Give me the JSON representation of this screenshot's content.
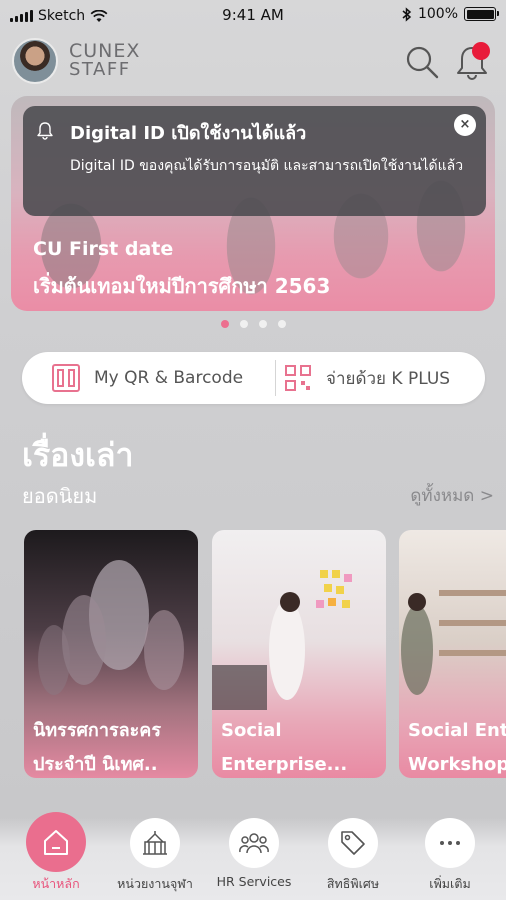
{
  "status_bar": {
    "carrier": "Sketch",
    "time": "9:41 AM",
    "battery": "100%",
    "battery_level": 1.0
  },
  "header": {
    "logo_top": "CUNEX",
    "logo_bottom": "STAFF",
    "search_icon": "search-icon",
    "bell_icon": "bell-icon",
    "has_unread_notification": true
  },
  "notification": {
    "title": "Digital ID เปิดใช้งานได้แล้ว",
    "body": "Digital ID ของคุณได้รับการอนุมัติ และสามารถเปิดใช้งานได้แล้ว",
    "close_symbol": "×"
  },
  "banner": {
    "line1": "CU First date",
    "line2": "เริ่มต้นเทอมใหม่ปีการศึกษา 2563",
    "slide_count": 4,
    "active_slide": 1
  },
  "actions": {
    "qr_label": "My QR & Barcode",
    "kplus_label": "จ่ายด้วย K PLUS"
  },
  "stories": {
    "title": "เรื่องเล่า",
    "subtitle": "ยอดนิยม",
    "see_all": "ดูทั้งหมด >",
    "cards": [
      {
        "line1": "นิทรรศการละคร",
        "line2": "ประจำปี นิเทศ.."
      },
      {
        "line1": "Social",
        "line2": "Enterprise..."
      },
      {
        "line1": "Social Ent",
        "line2": "Workshop"
      }
    ]
  },
  "nav": {
    "items": [
      {
        "label": "หน้าหลัก",
        "icon": "home-icon",
        "active": true
      },
      {
        "label": "หน่วยงานจุฬา",
        "icon": "building-icon",
        "active": false
      },
      {
        "label": "HR Services",
        "icon": "people-icon",
        "active": false
      },
      {
        "label": "สิทธิพิเศษ",
        "icon": "tag-icon",
        "active": false
      },
      {
        "label": "เพิ่มเติม",
        "icon": "more-icon",
        "active": false
      }
    ]
  },
  "colors": {
    "accent": "#ea6e8e",
    "notification_dot": "#e81b3a",
    "notification_bg": "#4a4a4e"
  }
}
